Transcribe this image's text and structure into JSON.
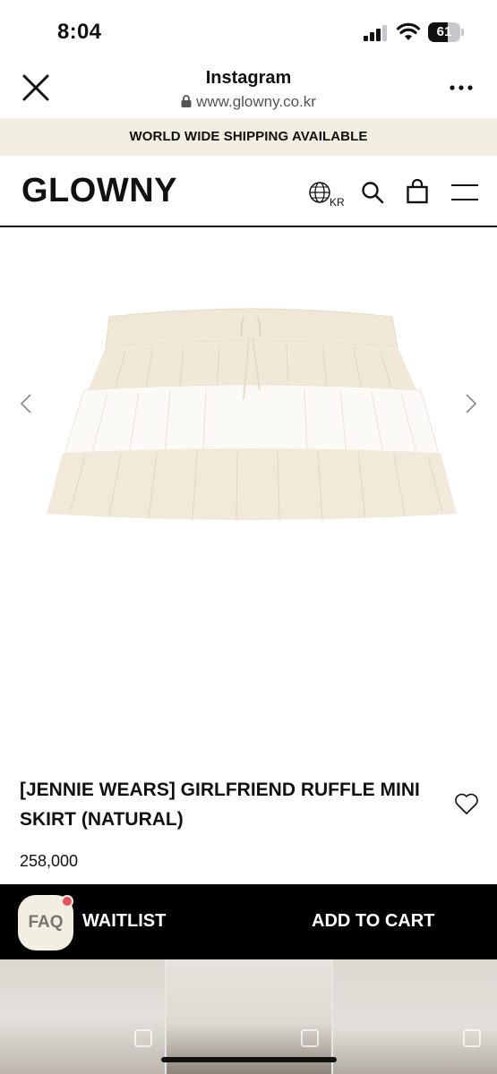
{
  "status_bar": {
    "time": "8:04",
    "battery_level": "61",
    "battery_fraction": 0.61
  },
  "browser": {
    "title": "Instagram",
    "url": "www.glowny.co.kr",
    "close_icon": "close-icon",
    "more_icon": "more-icon"
  },
  "banner": {
    "text": "WORLD WIDE SHIPPING AVAILABLE",
    "background": "#f2eee2"
  },
  "nav": {
    "logo": "GLOWNY",
    "region": "KR",
    "icons": [
      "globe-icon",
      "search-icon",
      "bag-icon",
      "menu-icon"
    ]
  },
  "product": {
    "name": "[JENNIE WEARS] GIRLFRIEND RUFFLE MINI SKIRT (NATURAL)",
    "price": "258,000",
    "image_colors": {
      "cream": "#f1eada",
      "white": "#fbfaf6"
    }
  },
  "action_bar": {
    "faq_label": "FAQ",
    "waitlist_label": "WAITLIST",
    "cart_label": "ADD TO CART",
    "background": "#000000",
    "badge_color": "#e8505b"
  }
}
